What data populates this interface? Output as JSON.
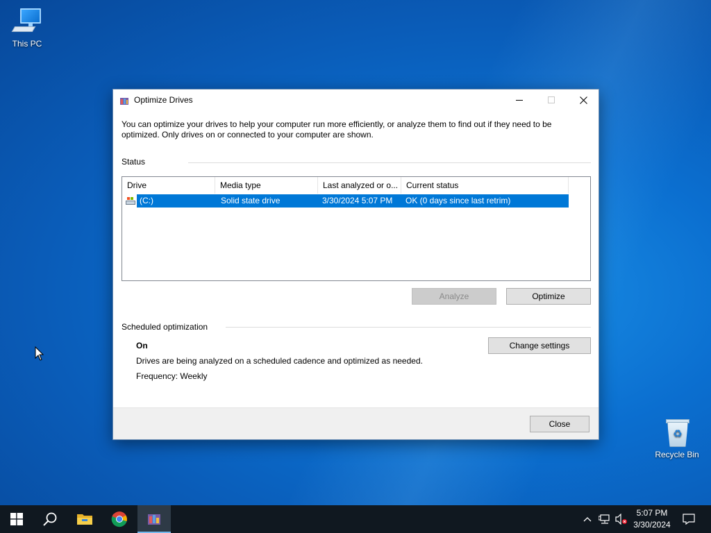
{
  "desktop": {
    "icons": [
      {
        "label": "This PC"
      },
      {
        "label": "Recycle Bin"
      }
    ]
  },
  "window": {
    "title": "Optimize Drives",
    "intro": "You can optimize your drives to help your computer run more efficiently, or analyze them to find out if they need to be optimized. Only drives on or connected to your computer are shown.",
    "status_label": "Status",
    "columns": [
      "Drive",
      "Media type",
      "Last analyzed or o...",
      "Current status"
    ],
    "drives": [
      {
        "drive": "(C:)",
        "media_type": "Solid state drive",
        "last_analyzed": "3/30/2024 5:07 PM",
        "status": "OK (0 days since last retrim)",
        "selected": true
      }
    ],
    "analyze_label": "Analyze",
    "optimize_label": "Optimize",
    "scheduled_label": "Scheduled optimization",
    "schedule_state": "On",
    "schedule_desc": "Drives are being analyzed on a scheduled cadence and optimized as needed.",
    "frequency": "Frequency: Weekly",
    "change_settings_label": "Change settings",
    "close_label": "Close"
  },
  "taskbar": {
    "apps": [
      "start-icon",
      "search-icon",
      "file-explorer-icon",
      "chrome-icon",
      "optimize-drives-icon"
    ],
    "time": "5:07 PM",
    "date": "3/30/2024"
  },
  "colors": {
    "selection": "#0078d7",
    "taskbar": "#101820",
    "desktop": "#0b6fd0"
  }
}
